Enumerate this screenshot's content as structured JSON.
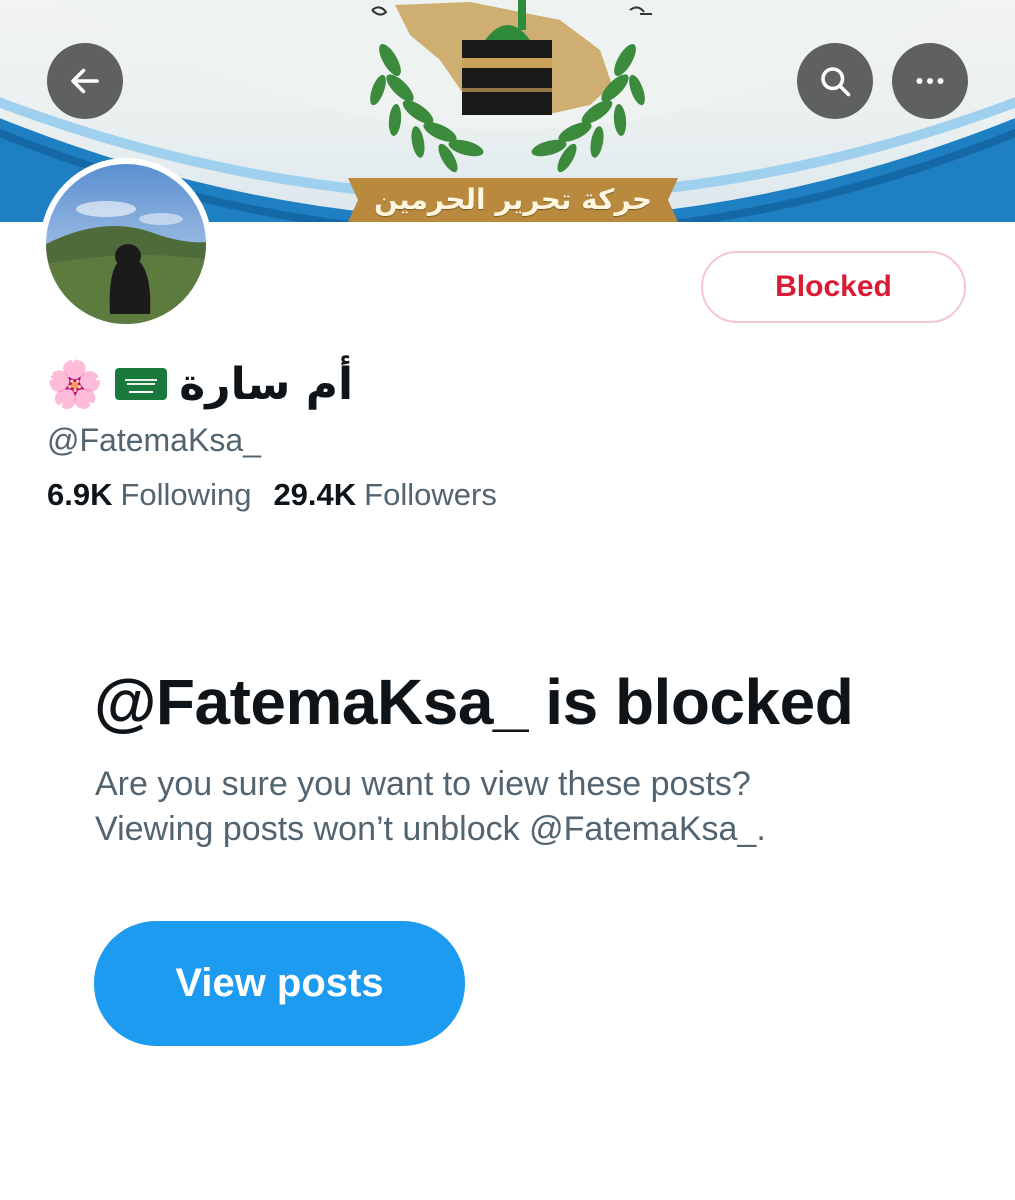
{
  "banner": {
    "text": "حركة تحرير الحرمين",
    "colors": {
      "arc": "#1e88c8",
      "gold": "#c9a35a",
      "leaf": "#3c8a3c",
      "kaaba": "#1a1a1a"
    }
  },
  "header": {
    "back_icon": "arrow-left-icon",
    "search_icon": "search-icon",
    "more_icon": "more-horizontal-icon"
  },
  "profile": {
    "name": "أم سارة",
    "name_emojis": [
      "🇸🇦",
      "🌸"
    ],
    "handle": "@FatemaKsa_",
    "following_count": "6.9K",
    "following_label": "Following",
    "followers_count": "29.4K",
    "followers_label": "Followers",
    "blocked_button": "Blocked"
  },
  "blocked_notice": {
    "title": "@FatemaKsa_ is blocked",
    "line1": "Are you sure you want to view these posts?",
    "line2": "Viewing posts won’t unblock @FatemaKsa_.",
    "view_posts_button": "View posts"
  },
  "colors": {
    "accent": "#1d9bf0",
    "blocked_red": "#d91c34",
    "muted_text": "#536471"
  }
}
